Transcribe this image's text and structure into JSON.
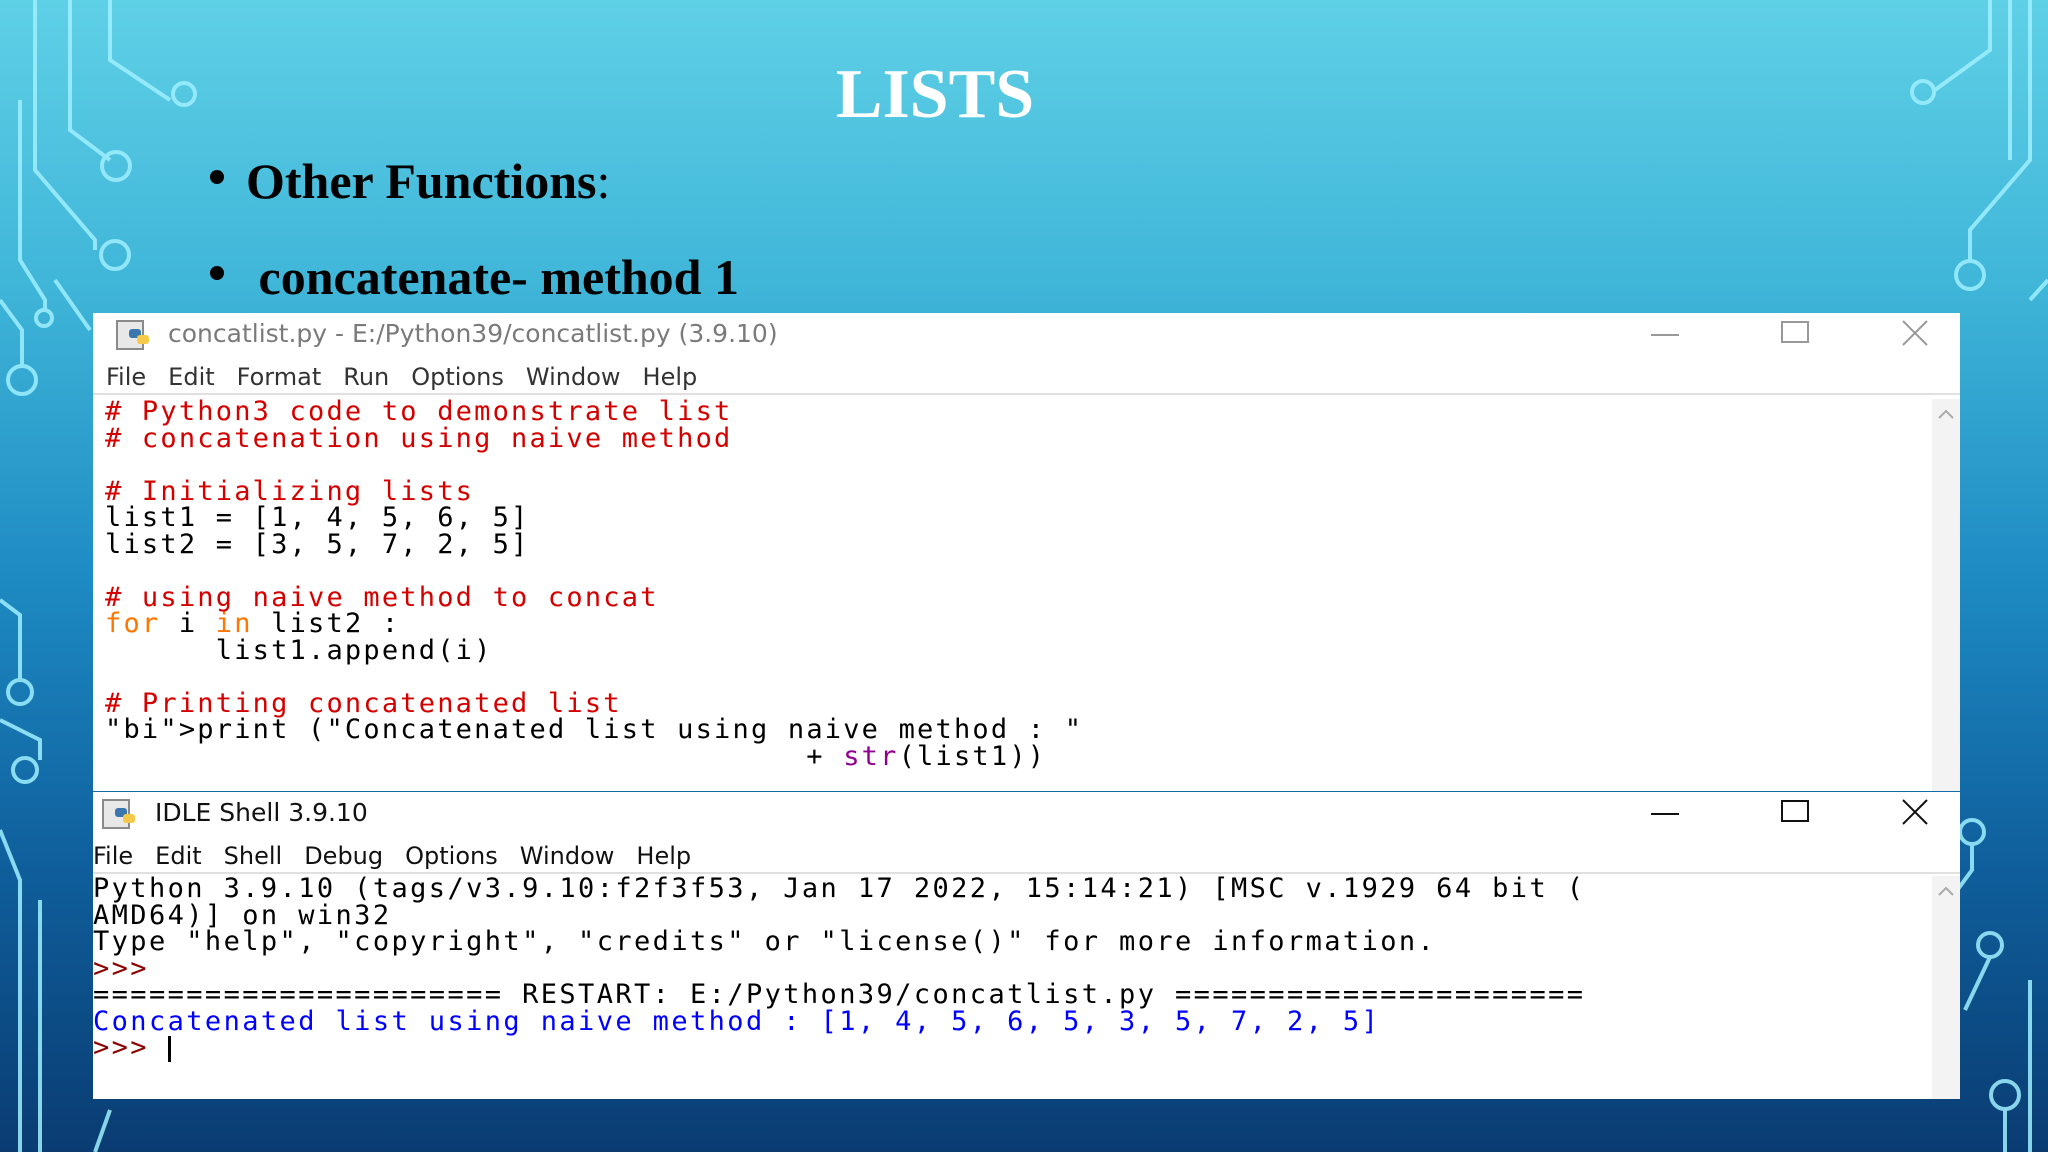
{
  "slide": {
    "title": "LISTS",
    "bullet1": "Other Functions",
    "bullet1_colon": ":",
    "bullet2": "concatenate- method 1"
  },
  "editor": {
    "title": "concatlist.py - E:/Python39/concatlist.py (3.9.10)",
    "menu": [
      "File",
      "Edit",
      "Format",
      "Run",
      "Options",
      "Window",
      "Help"
    ],
    "lines": [
      "# Python3 code to demonstrate list",
      "# concatenation using naive method",
      "",
      "# Initializing lists",
      "list1 = [1, 4, 5, 6, 5]",
      "list2 = [3, 5, 7, 2, 5]",
      "",
      "# using naive method to concat",
      "for i in list2 :",
      "      list1.append(i)",
      "",
      "# Printing concatenated list",
      "print (\"Concatenated list using naive method : \"",
      "                                      + str(list1))"
    ]
  },
  "shell": {
    "title": "IDLE Shell 3.9.10",
    "menu": [
      "File",
      "Edit",
      "Shell",
      "Debug",
      "Options",
      "Window",
      "Help"
    ],
    "lines": [
      "Python 3.9.10 (tags/v3.9.10:f2f3f53, Jan 17 2022, 15:14:21) [MSC v.1929 64 bit (",
      "AMD64)] on win32",
      "Type \"help\", \"copyright\", \"credits\" or \"license()\" for more information.",
      ">>> ",
      "====================== RESTART: E:/Python39/concatlist.py ======================",
      "Concatenated list using naive method : [1, 4, 5, 6, 5, 3, 5, 7, 2, 5]",
      ">>> "
    ]
  },
  "colors": {
    "comment": "#d40000",
    "keyword": "#ff7700",
    "builtin": "#900090",
    "string": "#00aa00",
    "output": "#0000ff"
  },
  "icons": [
    "python-file-icon",
    "minimize-icon",
    "maximize-icon",
    "close-icon",
    "scroll-up-icon"
  ]
}
